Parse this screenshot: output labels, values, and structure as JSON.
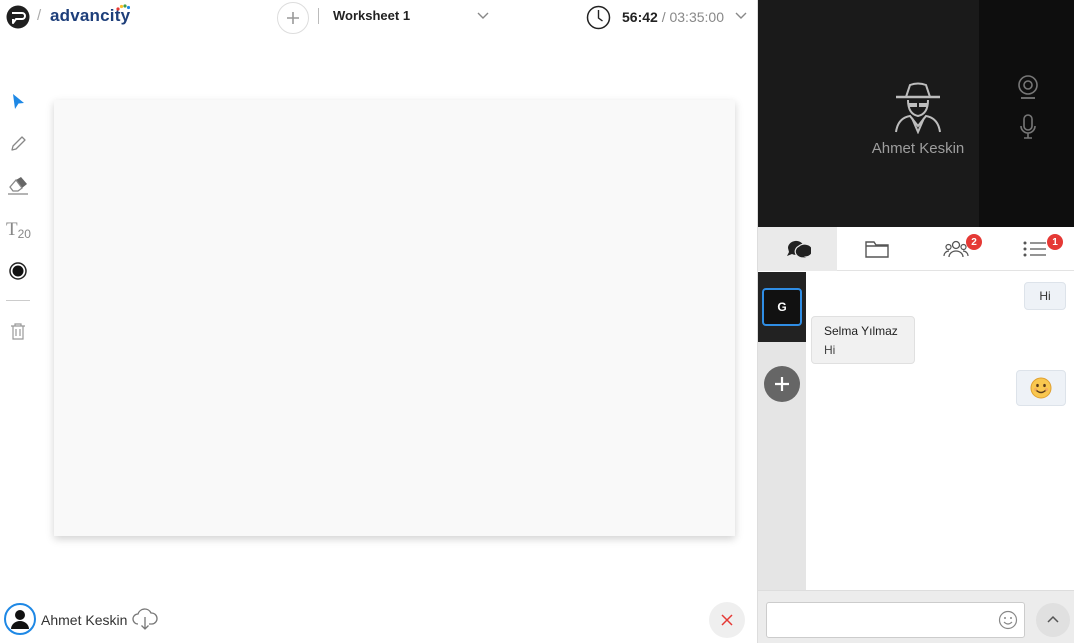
{
  "header": {
    "brand": "advancity",
    "separator": "/",
    "worksheet_title": "Worksheet 1",
    "timer_elapsed": "56:42",
    "timer_separator": " / ",
    "timer_total": "03:35:00"
  },
  "toolbar": {
    "text_tool_label": "T",
    "text_size": "20"
  },
  "footer": {
    "user_name": "Ahmet Keskin"
  },
  "video": {
    "participant_name": "Ahmet Keskin"
  },
  "tabs": {
    "participants_badge": "2",
    "list_badge": "1"
  },
  "chat": {
    "group_label": "G",
    "messages": [
      {
        "direction": "out",
        "text": "Hi"
      },
      {
        "direction": "in",
        "sender": "Selma Yılmaz",
        "text": "Hi"
      },
      {
        "direction": "out",
        "text": "😊"
      }
    ],
    "input_placeholder": ""
  },
  "colors": {
    "accent": "#1e88e5",
    "brand": "#1d3e7a",
    "badge": "#e53935",
    "video_bg": "#1a1a1a"
  }
}
